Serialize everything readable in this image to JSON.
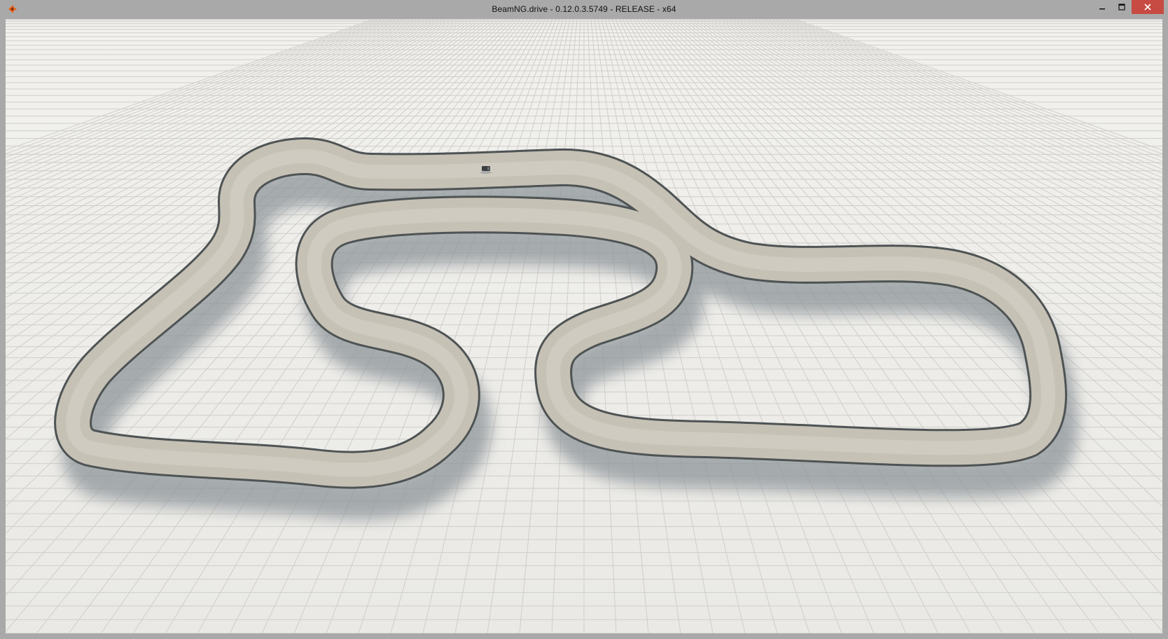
{
  "window": {
    "title": "BeamNG.drive - 0.12.0.3.5749 - RELEASE - x64",
    "app_icon": "beamng-logo-icon",
    "controls": [
      "minimize-icon",
      "maximize-icon",
      "close-icon"
    ]
  },
  "scene": {
    "ground": "grid-plane",
    "track": "gravel-race-track",
    "vehicle": "car",
    "colors": {
      "ground": "#efeeeb",
      "grid_line": "#c9c8c4",
      "road": "#c6c1b5",
      "road_edge": "#4e5354",
      "shadow": "#8e949a",
      "close_button": "#c74b43",
      "logo_orange": "#e8641b"
    }
  }
}
